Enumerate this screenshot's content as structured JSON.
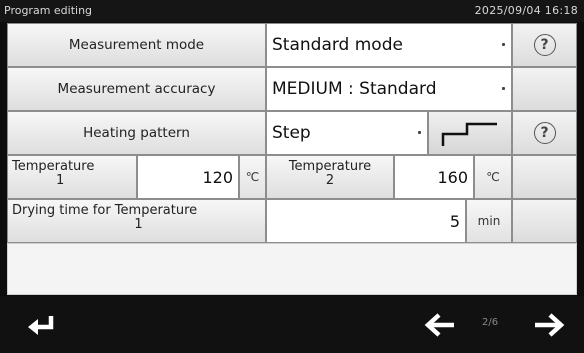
{
  "titlebar": {
    "title": "Program editing",
    "datetime": "2025/09/04 16:18"
  },
  "rows": {
    "mode": {
      "label": "Measurement mode",
      "value": "Standard mode"
    },
    "accuracy": {
      "label": "Measurement accuracy",
      "value": "MEDIUM : Standard"
    },
    "pattern": {
      "label": "Heating pattern",
      "value": "Step"
    },
    "temp1": {
      "label_line1": "Temperature",
      "label_line2": "1",
      "value": "120",
      "unit": "℃"
    },
    "temp2": {
      "label_line1": "Temperature",
      "label_line2": "2",
      "value": "160",
      "unit": "℃"
    },
    "drying": {
      "label_line1": "Drying time for Temperature",
      "label_line2": "1",
      "value": "5",
      "unit": "min"
    }
  },
  "help_symbol": "?",
  "footer": {
    "page_indicator": "2/6"
  },
  "icons": [
    "return-icon",
    "left-arrow-icon",
    "right-arrow-icon",
    "step-pattern-icon",
    "help-icon",
    "dropdown-dot-icon"
  ]
}
